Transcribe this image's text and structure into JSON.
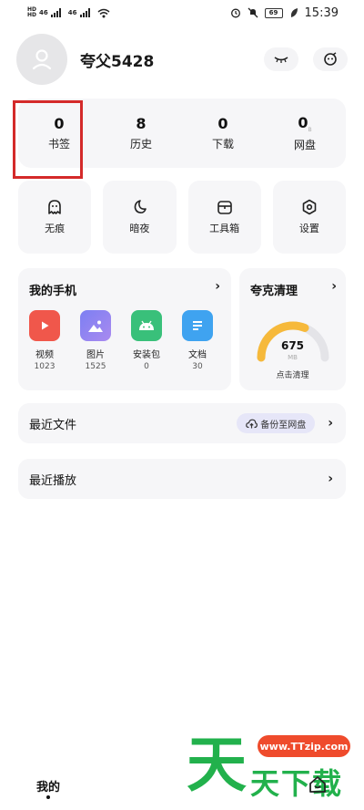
{
  "status_bar": {
    "network1": "46",
    "network2": "46",
    "battery": "69",
    "time": "15:39"
  },
  "profile": {
    "username": "夸父5428"
  },
  "stats": [
    {
      "value": "0",
      "label": "书签"
    },
    {
      "value": "8",
      "label": "历史"
    },
    {
      "value": "0",
      "label": "下载"
    },
    {
      "value": "0",
      "unit": "B",
      "label": "网盘"
    }
  ],
  "tools": [
    {
      "label": "无痕",
      "icon": "ghost-icon"
    },
    {
      "label": "暗夜",
      "icon": "moon-icon"
    },
    {
      "label": "工具箱",
      "icon": "toolbox-icon"
    },
    {
      "label": "设置",
      "icon": "gear-icon"
    }
  ],
  "my_phone": {
    "title": "我的手机",
    "arrow": "›",
    "items": [
      {
        "label": "视频",
        "count": "1023",
        "icon": "video-icon",
        "color": "#f0574b"
      },
      {
        "label": "图片",
        "count": "1525",
        "icon": "image-icon",
        "color": "#6f7df0"
      },
      {
        "label": "安装包",
        "count": "0",
        "icon": "android-icon",
        "color": "#39c07a"
      },
      {
        "label": "文档",
        "count": "30",
        "icon": "document-icon",
        "color": "#3fa3f0"
      }
    ]
  },
  "cleaner": {
    "title": "夸克清理",
    "arrow": "›",
    "value": "675",
    "unit": "MB",
    "action": "点击清理",
    "gauge_fraction": 0.62
  },
  "recent_files": {
    "title": "最近文件",
    "backup_label": "备份至网盘",
    "arrow": "›"
  },
  "recent_play": {
    "title": "最近播放",
    "arrow": "›"
  },
  "bottom_nav": {
    "tab_label": "我的"
  },
  "watermark": {
    "url": "www.TTzip.com",
    "big": "天",
    "small": "天下载"
  },
  "colors": {
    "card_bg": "#f6f6f8",
    "highlight": "#d42a2a",
    "gauge_fill": "#f6b93b",
    "watermark_green": "#22b14c"
  }
}
